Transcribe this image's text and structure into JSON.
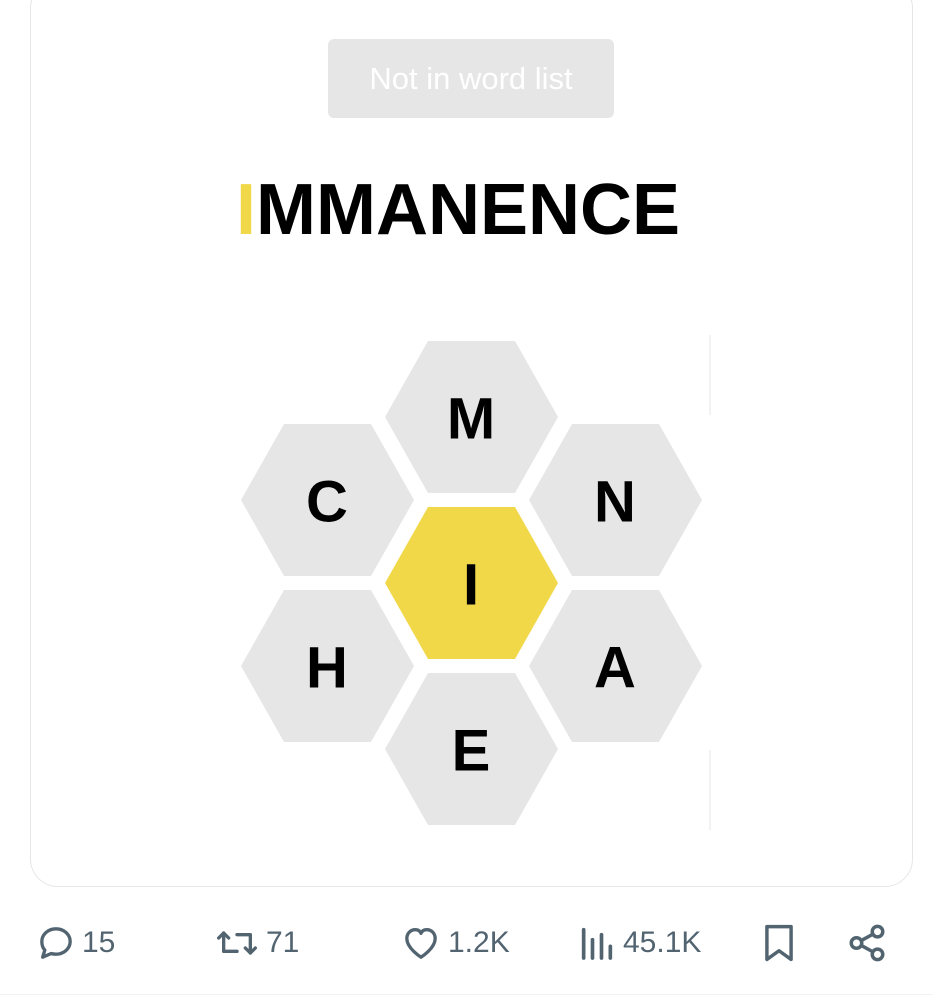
{
  "toast": {
    "message": "Not in word list"
  },
  "entry": {
    "letters": [
      "I",
      "M",
      "M",
      "A",
      "N",
      "E",
      "N",
      "C",
      "E"
    ],
    "center_letter": "I"
  },
  "hive": {
    "center": "I",
    "outer": {
      "top": "M",
      "upper_left": "C",
      "upper_right": "N",
      "lower_left": "H",
      "lower_right": "A",
      "bottom": "E"
    },
    "colors": {
      "center_fill": "#f1d849",
      "outer_fill": "#e6e6e6"
    }
  },
  "actions": {
    "replies": "15",
    "reposts": "71",
    "likes": "1.2K",
    "views": "45.1K"
  },
  "colors": {
    "action_icon": "#536471",
    "toast_bg": "#e6e6e6"
  }
}
